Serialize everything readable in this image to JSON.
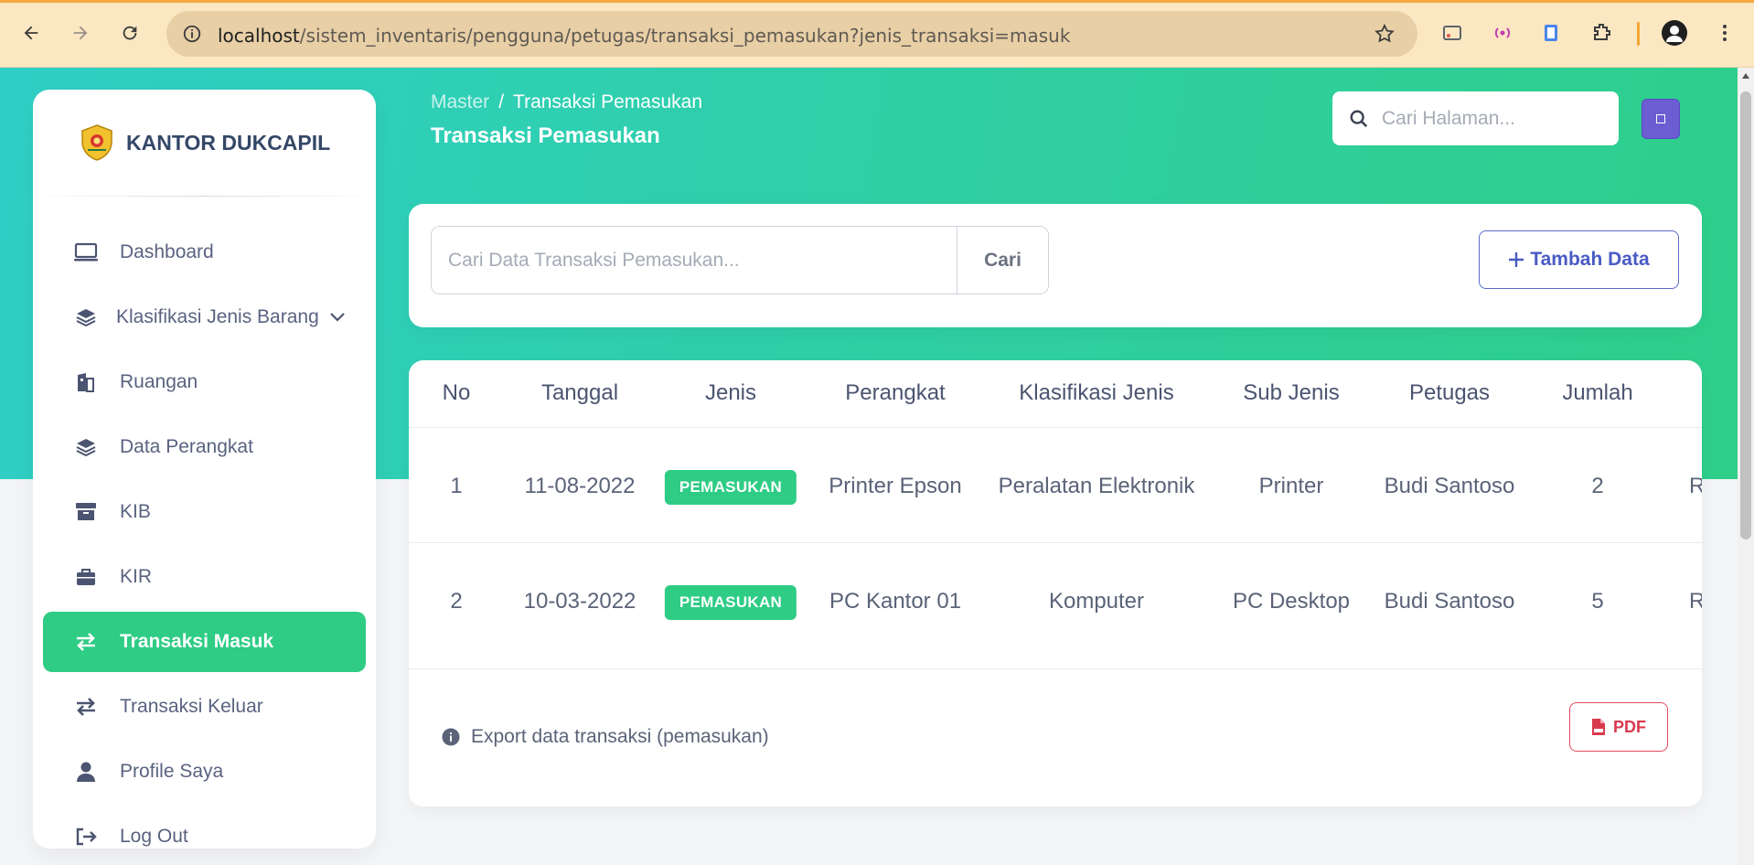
{
  "browser": {
    "url_host": "localhost",
    "url_path": "/sistem_inventaris/pengguna/petugas/transaksi_pemasukan?jenis_transaksi=masuk"
  },
  "sidebar": {
    "brand": "KANTOR DUKCAPIL",
    "items": [
      {
        "label": "Dashboard",
        "icon": "monitor-icon"
      },
      {
        "label": "Klasifikasi Jenis Barang",
        "icon": "layers-icon"
      },
      {
        "label": "Ruangan",
        "icon": "building-icon"
      },
      {
        "label": "Data Perangkat",
        "icon": "layers-icon"
      },
      {
        "label": "KIB",
        "icon": "archive-icon"
      },
      {
        "label": "KIR",
        "icon": "briefcase-icon"
      },
      {
        "label": "Transaksi Masuk",
        "icon": "exchange-icon"
      },
      {
        "label": "Transaksi Keluar",
        "icon": "exchange-icon"
      },
      {
        "label": "Profile Saya",
        "icon": "user-icon"
      },
      {
        "label": "Log Out",
        "icon": "logout-icon"
      }
    ]
  },
  "header": {
    "breadcrumb_root": "Master",
    "breadcrumb_sep": "/",
    "breadcrumb_current": "Transaksi Pemasukan",
    "title": "Transaksi Pemasukan",
    "search_placeholder": "Cari Halaman..."
  },
  "search_card": {
    "placeholder": "Cari Data Transaksi Pemasukan...",
    "search_button": "Cari",
    "add_button": "Tambah Data"
  },
  "table": {
    "columns": [
      "No",
      "Tanggal",
      "Jenis",
      "Perangkat",
      "Klasifikasi Jenis",
      "Sub Jenis",
      "Petugas",
      "Jumlah"
    ],
    "rows": [
      {
        "no": "1",
        "tanggal": "11-08-2022",
        "jenis": "PEMASUKAN",
        "perangkat": "Printer Epson",
        "klasifikasi": "Peralatan Elektronik",
        "sub_jenis": "Printer",
        "petugas": "Budi Santoso",
        "jumlah": "2",
        "harga_partial": "Rp"
      },
      {
        "no": "2",
        "tanggal": "10-03-2022",
        "jenis": "PEMASUKAN",
        "perangkat": "PC Kantor 01",
        "klasifikasi": "Komputer",
        "sub_jenis": "PC Desktop",
        "petugas": "Budi Santoso",
        "jumlah": "5",
        "harga_partial": "Rp"
      }
    ],
    "export_text": "Export data transaksi (pemasukan)",
    "pdf_button": "PDF"
  },
  "colors": {
    "accent_green": "#2ecc84",
    "brand_purple": "#6c5dd3",
    "add_button_blue": "#4a5bc4",
    "pdf_red": "#d93a4d"
  }
}
